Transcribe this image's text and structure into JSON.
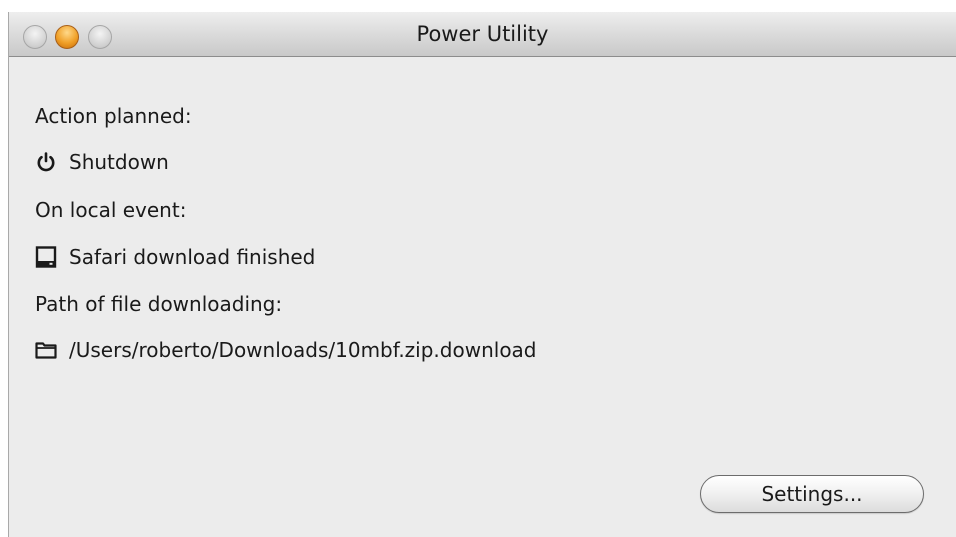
{
  "window": {
    "title": "Power Utility"
  },
  "content": {
    "action_label": "Action planned:",
    "action_value": "Shutdown",
    "action_icon": "power-icon",
    "event_label": "On local event:",
    "event_value": "Safari download finished",
    "event_icon": "disk-icon",
    "path_label": "Path of file downloading:",
    "path_value": "/Users/roberto/Downloads/10mbf.zip.download",
    "path_icon": "folder-icon"
  },
  "buttons": {
    "settings_label": "Settings..."
  },
  "colors": {
    "window_background": "#ececec",
    "minimize_button": "#f0a028"
  }
}
